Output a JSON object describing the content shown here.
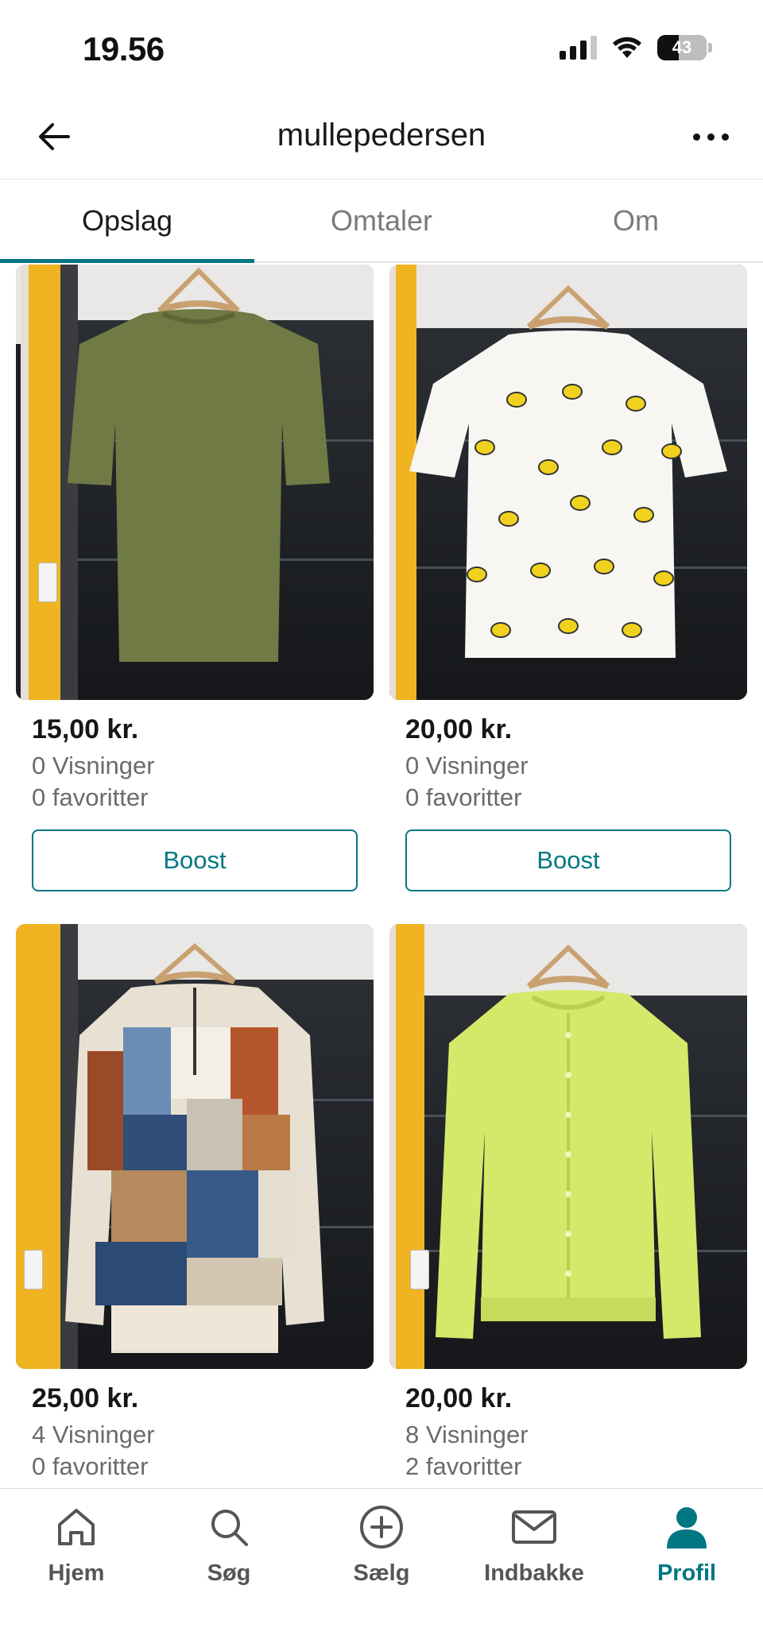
{
  "status_bar": {
    "time": "19.56",
    "battery": "43",
    "battery_level": 0.43
  },
  "header": {
    "title": "mullepedersen"
  },
  "tabs": [
    {
      "label": "Opslag",
      "active": true
    },
    {
      "label": "Omtaler",
      "active": false
    },
    {
      "label": "Om",
      "active": false
    }
  ],
  "listings": [
    {
      "price": "15,00 kr.",
      "views": "0 Visninger",
      "favorites": "0 favoritter",
      "boost_label": "Boost",
      "item": "green sparkle t-shirt",
      "color": "#6f7a45"
    },
    {
      "price": "20,00 kr.",
      "views": "0 Visninger",
      "favorites": "0 favoritter",
      "boost_label": "Boost",
      "item": "white t-shirt with yellow print",
      "color": "#f7f6f2"
    },
    {
      "price": "25,00 kr.",
      "views": "4 Visninger",
      "favorites": "0 favoritter",
      "item": "patchwork zip sweater",
      "color": "#e8e0d2"
    },
    {
      "price": "20,00 kr.",
      "views": "8 Visninger",
      "favorites": "2 favoritter",
      "item": "lime cardigan",
      "color": "#d4e86a"
    }
  ],
  "bottom_nav": [
    {
      "label": "Hjem",
      "icon": "home-icon",
      "active": false
    },
    {
      "label": "Søg",
      "icon": "search-icon",
      "active": false
    },
    {
      "label": "Sælg",
      "icon": "plus-circle-icon",
      "active": false
    },
    {
      "label": "Indbakke",
      "icon": "mail-icon",
      "active": false
    },
    {
      "label": "Profil",
      "icon": "profile-icon",
      "active": true
    }
  ],
  "colors": {
    "accent": "#007782",
    "text": "#161616",
    "muted": "#6b6b6b"
  }
}
